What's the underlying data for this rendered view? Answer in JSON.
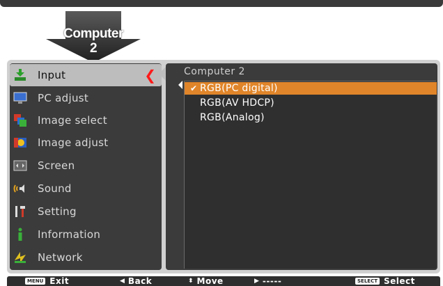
{
  "header": {
    "arrow_label_line1": "Computer",
    "arrow_label_line2": "2"
  },
  "menu": {
    "items": [
      {
        "label": "Input",
        "icon": "input-icon",
        "selected": true
      },
      {
        "label": "PC adjust",
        "icon": "pc-adjust-icon",
        "selected": false
      },
      {
        "label": "Image select",
        "icon": "image-select-icon",
        "selected": false
      },
      {
        "label": "Image adjust",
        "icon": "image-adjust-icon",
        "selected": false
      },
      {
        "label": "Screen",
        "icon": "screen-icon",
        "selected": false
      },
      {
        "label": "Sound",
        "icon": "sound-icon",
        "selected": false
      },
      {
        "label": "Setting",
        "icon": "setting-icon",
        "selected": false
      },
      {
        "label": "Information",
        "icon": "information-icon",
        "selected": false
      },
      {
        "label": "Network",
        "icon": "network-icon",
        "selected": false
      }
    ]
  },
  "submenu": {
    "title": "Computer 2",
    "options": [
      {
        "label": "RGB(PC digital)",
        "selected": true
      },
      {
        "label": "RGB(AV HDCP)",
        "selected": false
      },
      {
        "label": "RGB(Analog)",
        "selected": false
      }
    ]
  },
  "footer": {
    "exit_key": "MENU",
    "exit_label": "Exit",
    "back_label": "Back",
    "move_label": "Move",
    "next_label": "-----",
    "select_key": "SELECT",
    "select_label": "Select"
  },
  "colors": {
    "selection_accent": "#e0852a",
    "selected_chevron": "#ff1a1a"
  }
}
